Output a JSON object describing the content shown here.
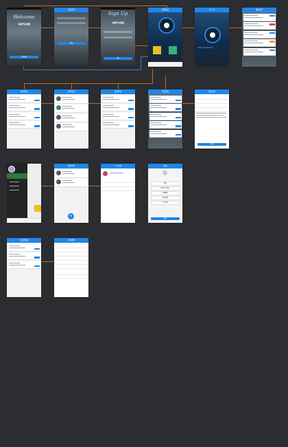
{
  "screens": {
    "welcome": {
      "title": "Welcome",
      "brand": "中国汽车联盟",
      "button": "立即注册"
    },
    "login": {
      "header": "会员登录",
      "fields": [
        "请输入用户名",
        "请输入密码"
      ],
      "button": "登录"
    },
    "signup": {
      "title": "Sign Up",
      "brand": "中国汽车联盟",
      "button": "注册"
    },
    "home": {
      "header": "首页概述",
      "tiles": [
        "待办事项",
        "已办事项"
      ]
    },
    "scan": {
      "header": "扫一扫",
      "caption": "正在识别，请将二维码放入框内"
    },
    "tasklist": {
      "header": "我的任务"
    },
    "list1": {
      "header": "待办列表"
    },
    "list2": {
      "header": "任务列表"
    },
    "list3": {
      "header": "待办列表"
    },
    "list4": {
      "header": "待办列表"
    },
    "detail": {
      "header": "详情信息",
      "button": "确定"
    },
    "drawer": {
      "header": ""
    },
    "members": {
      "header": "成员列表"
    },
    "profile": {
      "header": "个人信息"
    },
    "settings": {
      "header": "设置",
      "items": [
        "通知",
        "更新(1.0版本)",
        "清理缓存",
        "意见反馈",
        "关于我们"
      ],
      "button": "退出"
    },
    "list5": {
      "header": "已完成列表"
    },
    "detail2": {
      "header": "任务详情"
    }
  },
  "colors": {
    "accent": "#1f86e6",
    "connector": "#c56a1c",
    "background": "#2b2d30"
  }
}
